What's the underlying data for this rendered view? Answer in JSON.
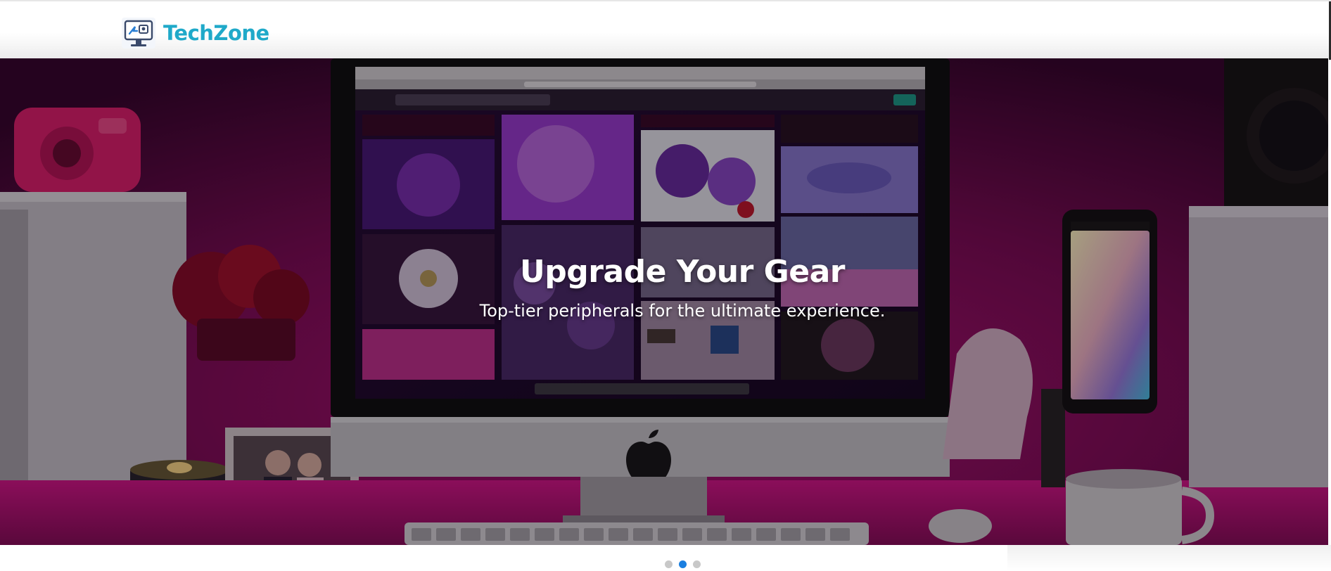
{
  "header": {
    "brand_name": "TechZone",
    "logo_icon": "monitor-logo-icon"
  },
  "hero": {
    "title": "Upgrade Your Gear",
    "subtitle": "Top-tier peripherals for the ultimate experience.",
    "background": "desk-setup-image"
  },
  "carousel": {
    "slides": 3,
    "active_index": 1
  },
  "colors": {
    "brand": "#1fa9c9",
    "indicator_active": "#1a7fe0",
    "indicator_inactive": "#c8c8c8",
    "hero_accent": "#c0157f"
  }
}
